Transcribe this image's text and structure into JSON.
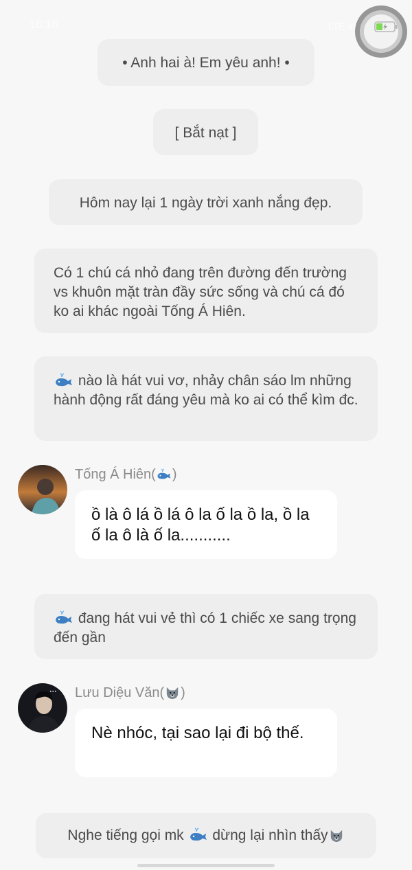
{
  "status_bar": {
    "time": "16:16",
    "signal": "LTE ııl"
  },
  "messages": [
    {
      "type": "narration",
      "text": "• Anh hai à! Em yêu anh! •"
    },
    {
      "type": "narration",
      "text": "[ Bắt nạt ]"
    },
    {
      "type": "narration",
      "text": "Hôm nay lại 1 ngày trời xanh nắng đẹp."
    },
    {
      "type": "narration",
      "text": "Có 1 chú cá nhỏ đang trên đường đến trường vs khuôn mặt tràn đầy sức sống và chú cá đó ko ai khác ngoài Tống Á Hiên."
    },
    {
      "type": "narration",
      "icon": "whale-icon",
      "text": "nào là hát vui vơ, nhảy chân sáo lm những hành động rất đáng yêu mà ko ai có thể kìm đc."
    },
    {
      "type": "character",
      "name": "Tống Á Hiên(",
      "name_icon": "whale-icon",
      "name_suffix": ")",
      "text": "ồ là ô lá ồ lá ô la ố la ồ la, ồ la ố la ô là ố la..........."
    },
    {
      "type": "narration",
      "icon": "whale-icon",
      "text": "đang hát vui vẻ thì có 1 chiếc xe sang trọng đến gần"
    },
    {
      "type": "character",
      "name": "Lưu Diệu Văn(",
      "name_icon": "wolf-icon",
      "name_suffix": ")",
      "text": "Nè nhóc, tại sao lại đi bộ thế."
    },
    {
      "type": "narration",
      "text_before": "Nghe tiếng gọi mk",
      "icon": "whale-icon",
      "text_after": "dừng lại nhìn thấy",
      "icon_after": "wolf-icon"
    }
  ],
  "colors": {
    "background": "#f7f7f7",
    "narration_bg": "#eeeeee",
    "bubble_bg": "#ffffff",
    "name_text": "#8a8a8a",
    "whale": "#3d7fc2"
  }
}
